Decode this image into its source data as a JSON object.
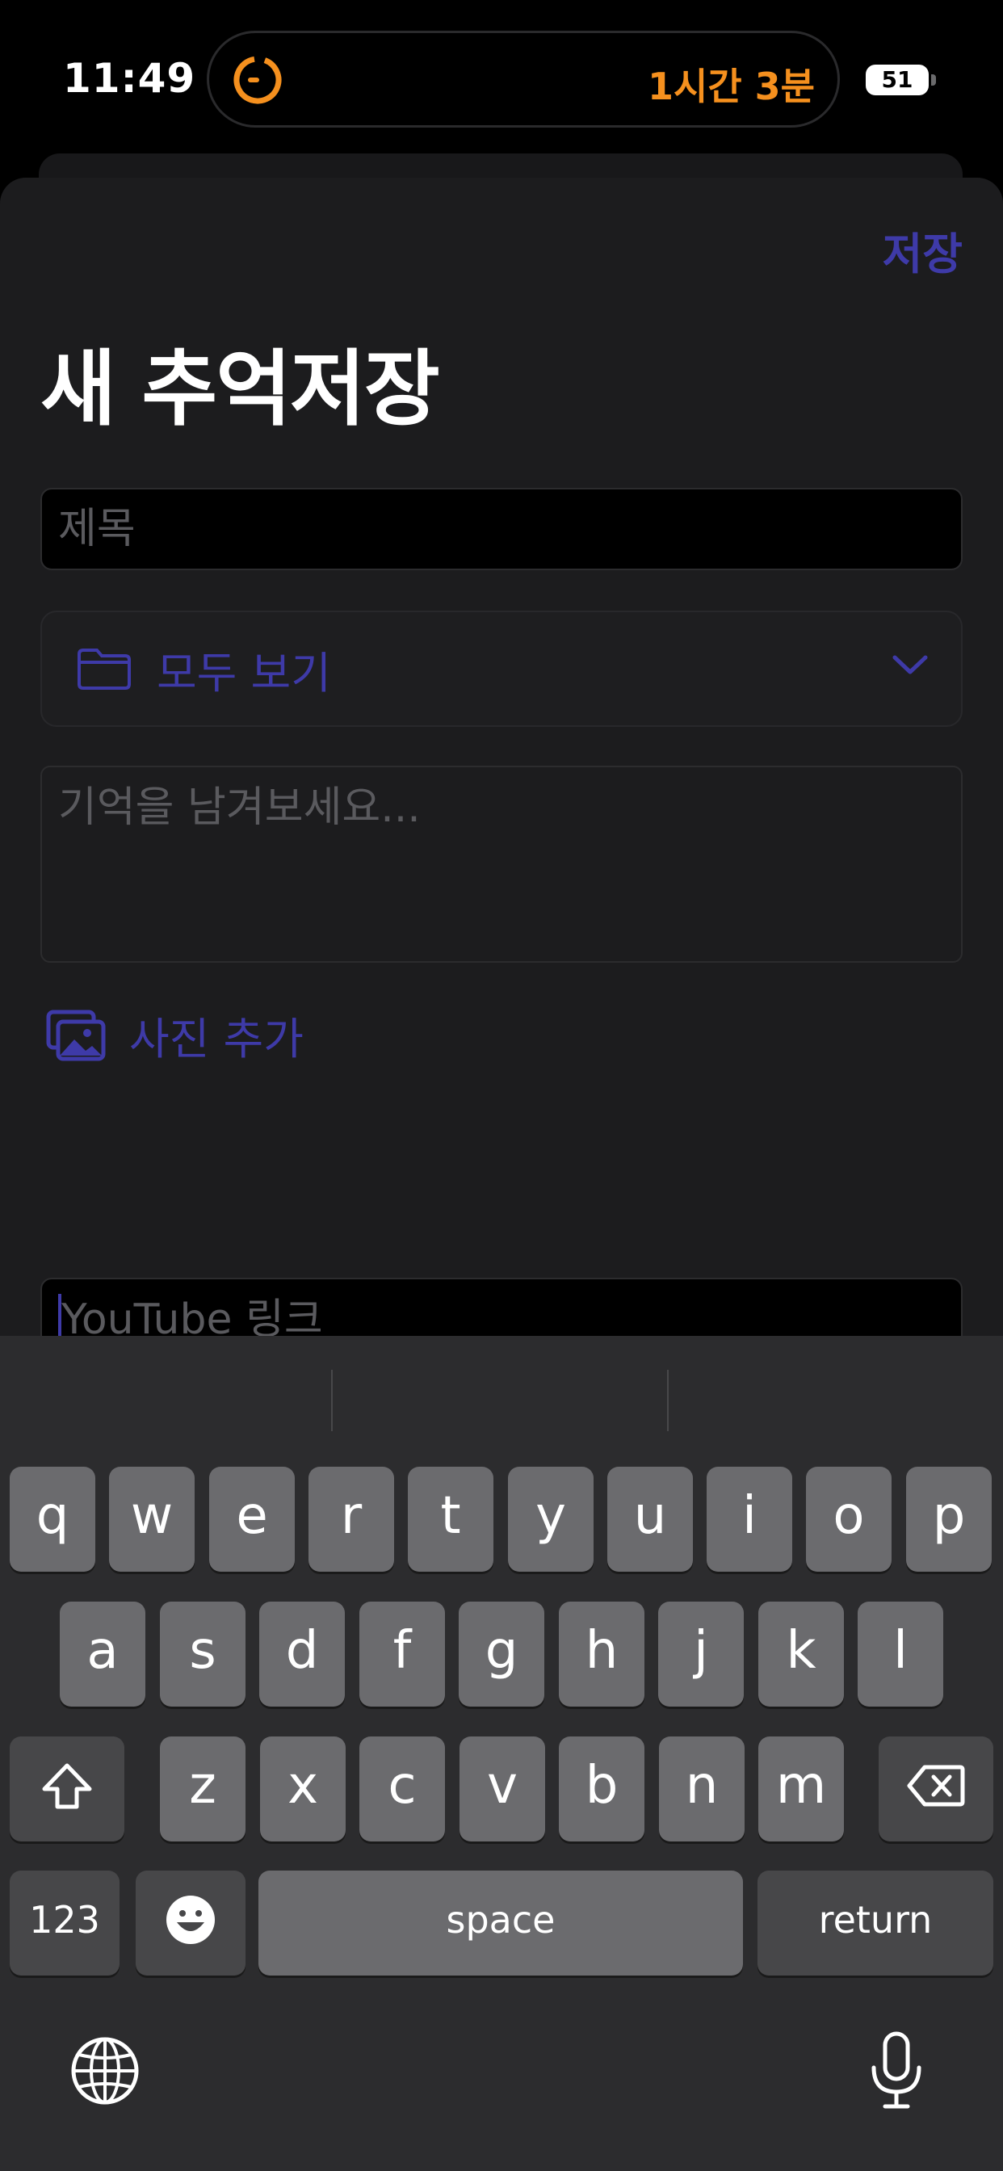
{
  "status_bar": {
    "time": "11:49",
    "activity_timer": "1시간 3분",
    "battery_level": "51",
    "accent_color": "#f5901e"
  },
  "header": {
    "save_label": "저장",
    "title": "새 추억저장"
  },
  "form": {
    "title_placeholder": "제목",
    "folder_label": "모두 보기",
    "memo_placeholder": "기억을 남겨보세요...",
    "add_photo_label": "사진 추가",
    "youtube_placeholder": "YouTube 링크",
    "accent_color": "#3e3aa8"
  },
  "keyboard": {
    "row1": [
      "q",
      "w",
      "e",
      "r",
      "t",
      "y",
      "u",
      "i",
      "o",
      "p"
    ],
    "row2": [
      "a",
      "s",
      "d",
      "f",
      "g",
      "h",
      "j",
      "k",
      "l"
    ],
    "row3": [
      "z",
      "x",
      "c",
      "v",
      "b",
      "n",
      "m"
    ],
    "numbers_label": "123",
    "space_label": "space",
    "return_label": "return",
    "icons": [
      "shift-icon",
      "delete-icon",
      "emoji-icon",
      "globe-icon",
      "microphone-icon"
    ]
  }
}
